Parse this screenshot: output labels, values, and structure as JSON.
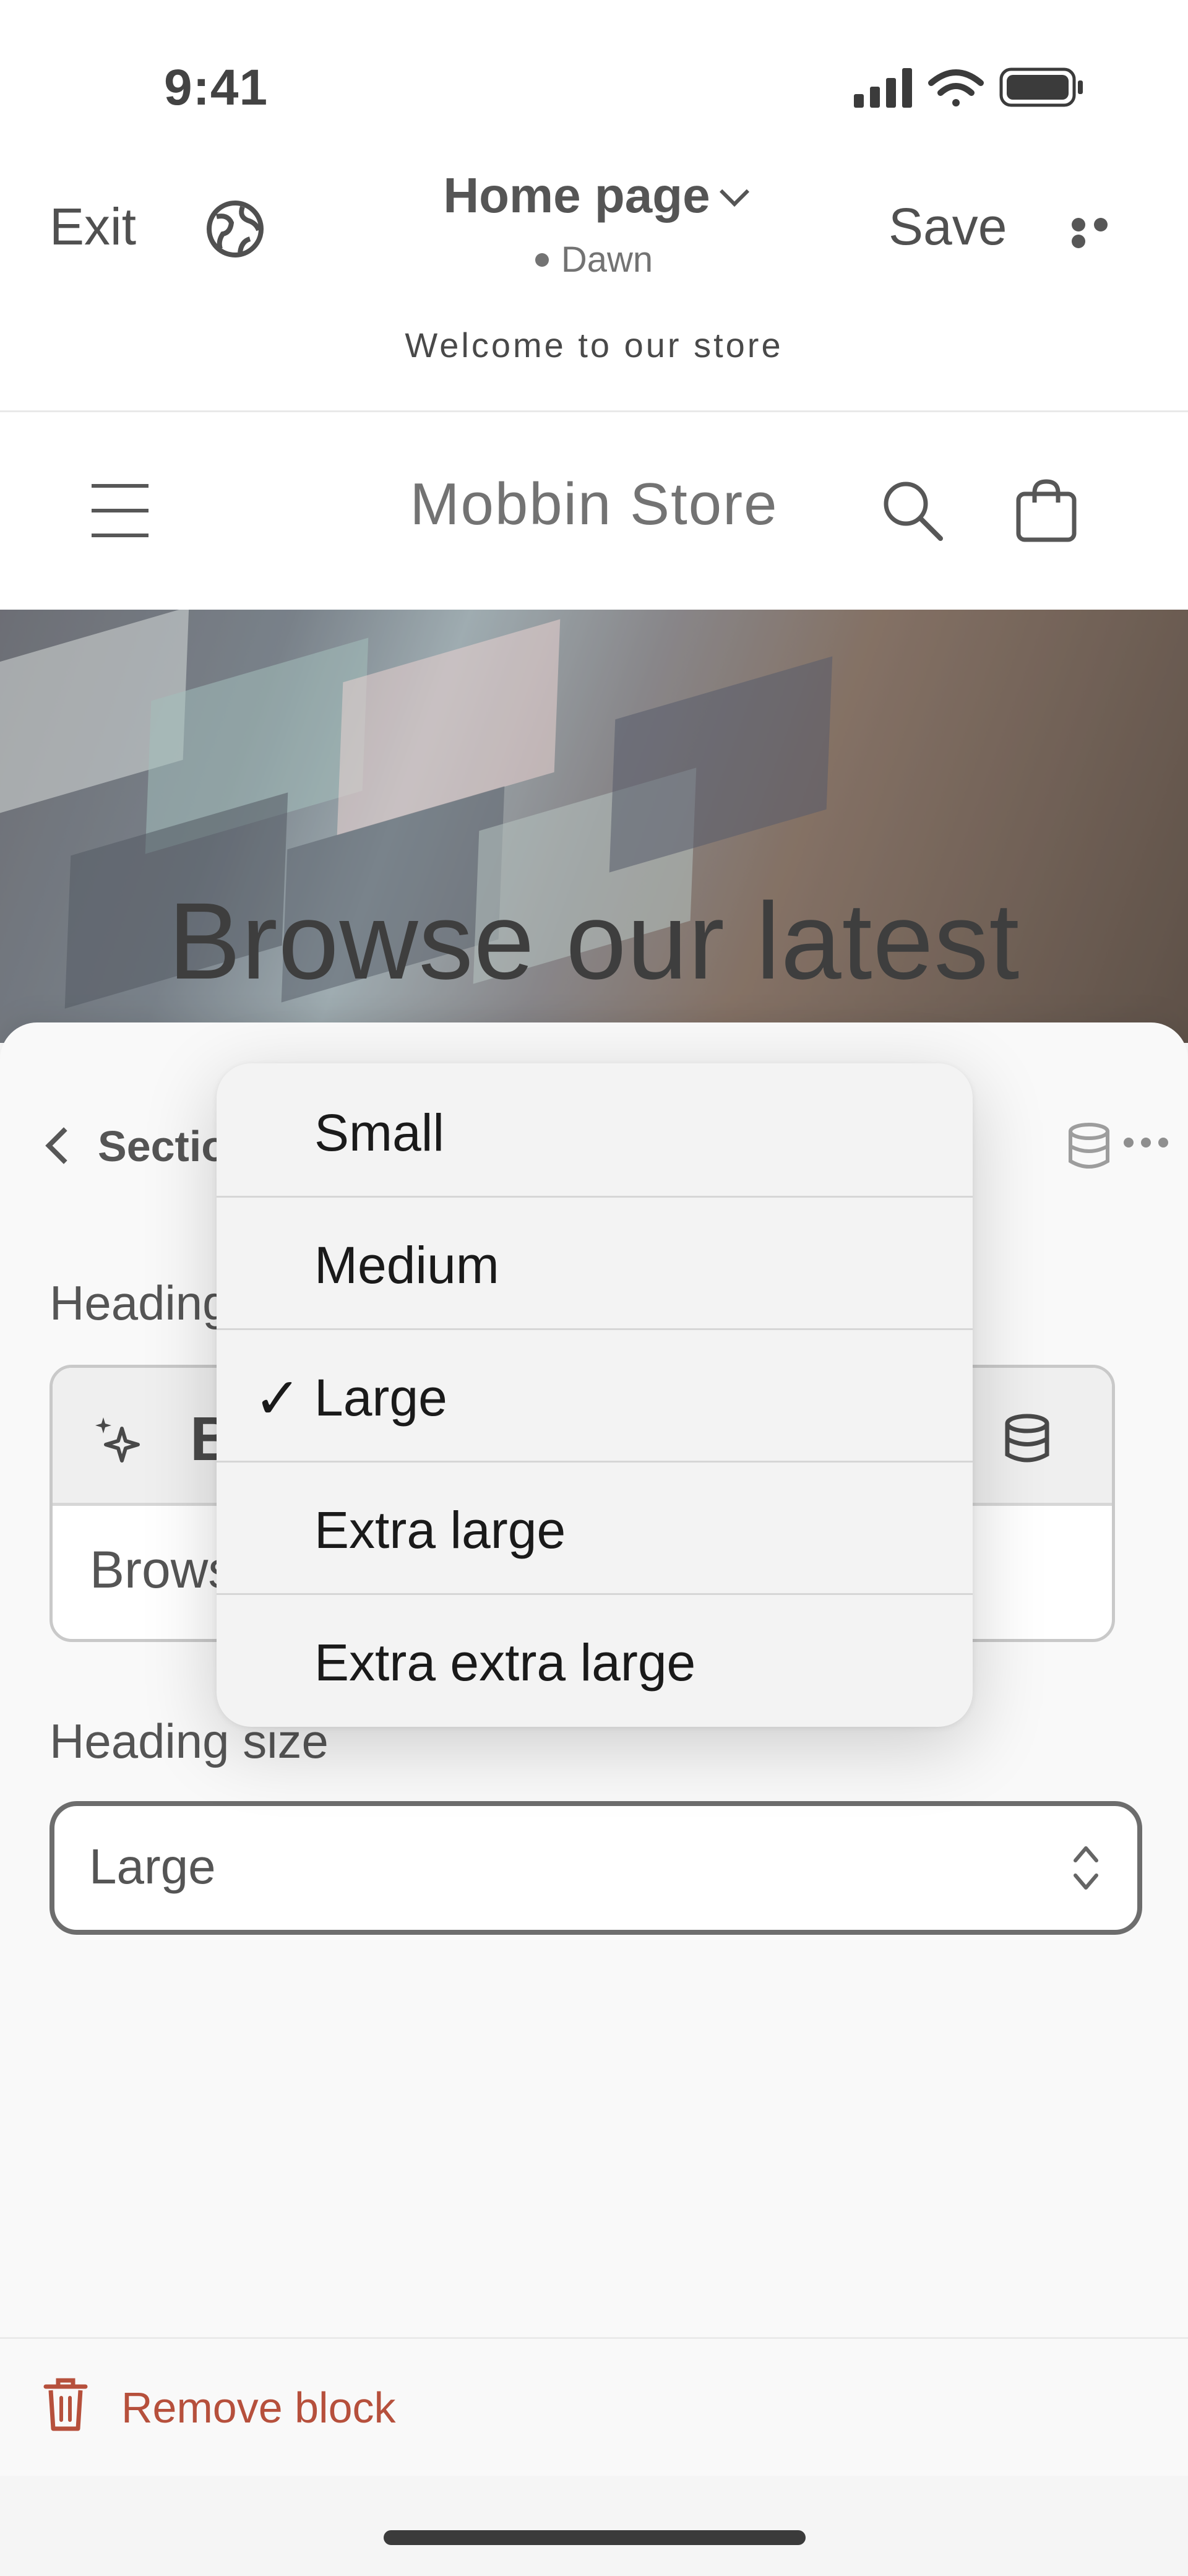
{
  "status_bar": {
    "time": "9:41"
  },
  "topbar": {
    "exit_label": "Exit",
    "page_title": "Home page",
    "theme_name": "Dawn",
    "save_label": "Save"
  },
  "store": {
    "announcement": "Welcome to our store",
    "name": "Mobbin Store",
    "hero_heading": "Browse our latest"
  },
  "sheet": {
    "back_label": "Sectio",
    "heading_label": "Heading",
    "toolbar_bold": "B",
    "heading_value": "Brows",
    "heading_size_label": "Heading size",
    "heading_size_value": "Large",
    "remove_label": "Remove block",
    "remove_color": "#a72a12"
  },
  "menu": {
    "options": [
      "Small",
      "Medium",
      "Large",
      "Extra large",
      "Extra extra large"
    ],
    "selected": "Large",
    "check_glyph": "✓"
  }
}
